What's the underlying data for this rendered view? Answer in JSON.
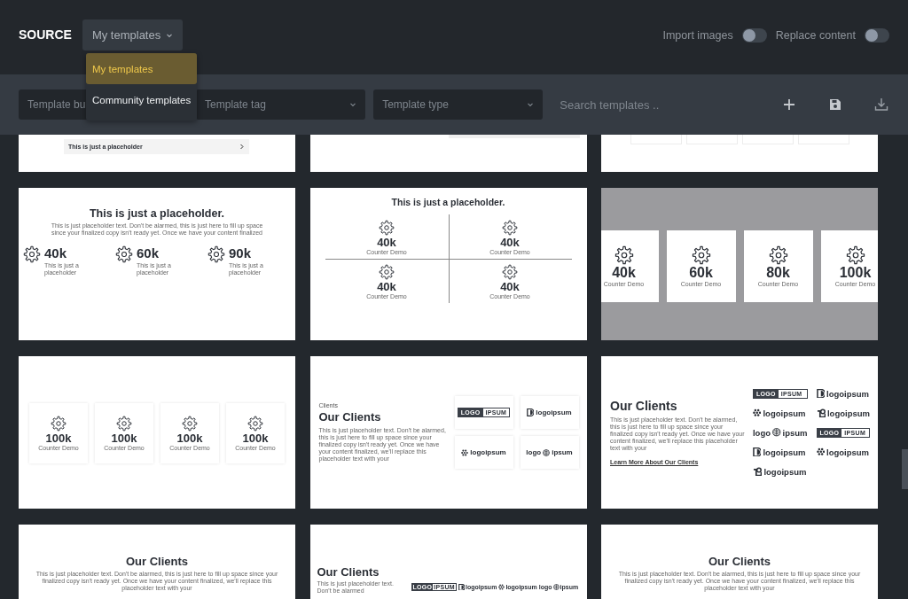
{
  "header": {
    "title": "SOURCE",
    "source_select": {
      "value": "My templates"
    },
    "source_menu": [
      {
        "label": "My templates",
        "selected": true
      },
      {
        "label": "Community templates",
        "selected": false
      }
    ],
    "toggles": [
      {
        "label": "Import images",
        "on": false
      },
      {
        "label": "Replace content",
        "on": false
      }
    ]
  },
  "filters": {
    "selects": [
      {
        "placeholder": "Template bu"
      },
      {
        "placeholder": "Template tag"
      },
      {
        "placeholder": "Template type"
      }
    ],
    "search": {
      "placeholder": "Search templates .."
    }
  },
  "template_rows": [
    {
      "cards": [
        {
          "kind": "bar",
          "text": "This is just a placeholder"
        },
        {
          "kind": "cut-bar"
        },
        {
          "kind": "box-bottoms"
        }
      ]
    },
    {
      "cards": [
        {
          "kind": "stats-inline",
          "title": "This is just a placeholder.",
          "text": "This is just placeholder text. Don't be alarmed, this is just here to fill up space since your finalized copy isn't ready yet. Once we have your content finalized",
          "stats": [
            {
              "value": "40k",
              "label": "This is just a placeholder"
            },
            {
              "value": "60k",
              "label": "This is just a placeholder"
            },
            {
              "value": "90k",
              "label": "This is just a placeholder"
            }
          ]
        },
        {
          "kind": "stats-grid",
          "title": "This is just a placeholder.",
          "stats": [
            {
              "value": "40k",
              "label": "Counter Demo"
            },
            {
              "value": "40k",
              "label": "Counter Demo"
            },
            {
              "value": "40k",
              "label": "Counter Demo"
            },
            {
              "value": "40k",
              "label": "Counter Demo"
            }
          ]
        },
        {
          "kind": "stats-grey",
          "stats": [
            {
              "value": "40k",
              "label": "Counter Demo"
            },
            {
              "value": "60k",
              "label": "Counter Demo"
            },
            {
              "value": "80k",
              "label": "Counter Demo"
            },
            {
              "value": "100k",
              "label": "Counter Demo"
            }
          ]
        }
      ]
    },
    {
      "cards": [
        {
          "kind": "stat-cards",
          "stats": [
            {
              "value": "100k",
              "label": "Counter Demo"
            },
            {
              "value": "100k",
              "label": "Counter Demo"
            },
            {
              "value": "100k",
              "label": "Counter Demo"
            },
            {
              "value": "100k",
              "label": "Counter Demo"
            }
          ]
        },
        {
          "kind": "clients-tiles",
          "eyebrow": "Clients",
          "title": "Our Clients",
          "text": "This is just placeholder text. Don't be alarmed, this is just here to fill up space since your finalized copy isn't ready yet. Once we have your content finalized, we'll replace this placeholder text with your",
          "logos": [
            {
              "kind": "boxed",
              "texts": [
                "LOGO",
                "IPSUM"
              ]
            },
            {
              "kind": "half-circle",
              "texts": [
                "logoipsum"
              ]
            },
            {
              "kind": "dots",
              "texts": [
                "logoipsum"
              ]
            },
            {
              "kind": "globe",
              "texts": [
                "logo",
                "ipsum"
              ]
            }
          ]
        },
        {
          "kind": "clients-list",
          "title": "Our Clients",
          "text": "This is just placeholder text. Don't be alarmed, this is just here to fill up space since your finalized copy isn't ready yet. Once we have your content finalized, we'll replace this placeholder text with your",
          "link": "Learn More About Our Clients",
          "logos": [
            {
              "kind": "boxed",
              "texts": [
                "LOGO",
                "IPSUM"
              ]
            },
            {
              "kind": "half-circle",
              "texts": [
                "logoipsum"
              ]
            },
            {
              "kind": "dots",
              "texts": [
                "logoipsum"
              ]
            },
            {
              "kind": "square",
              "texts": [
                "logoipsum"
              ]
            },
            {
              "kind": "globe",
              "texts": [
                "logo",
                "ipsum"
              ]
            },
            {
              "kind": "boxed",
              "texts": [
                "LOGO",
                "IPSUM"
              ]
            },
            {
              "kind": "half-circle",
              "texts": [
                "logoipsum"
              ]
            },
            {
              "kind": "dots",
              "texts": [
                "logoipsum"
              ]
            },
            {
              "kind": "square",
              "texts": [
                "logoipsum"
              ]
            }
          ]
        }
      ]
    },
    {
      "cards": [
        {
          "kind": "centered",
          "title": "Our Clients",
          "text": "This is just placeholder text. Don't be alarmed, this is just here to fill up space since your finalized copy isn't ready yet. Once we have your content finalized, we'll replace this placeholder text with your"
        },
        {
          "kind": "clients-row",
          "title": "Our Clients",
          "text": "This is just placeholder text. Don't be alarmed",
          "logos": [
            {
              "kind": "boxed",
              "texts": [
                "LOGO",
                "IPSUM"
              ]
            },
            {
              "kind": "half-circle",
              "texts": [
                "logoipsum"
              ]
            },
            {
              "kind": "dots",
              "texts": [
                "logoipsum"
              ]
            },
            {
              "kind": "globe",
              "texts": [
                "logo",
                "ipsum"
              ]
            }
          ]
        },
        {
          "kind": "centered",
          "title": "Our Clients",
          "text": "This is just placeholder text. Don't be alarmed, this is just here to fill up space since your finalized copy isn't ready yet. Once we have your content finalized, we'll replace this placeholder text with your"
        }
      ]
    }
  ]
}
